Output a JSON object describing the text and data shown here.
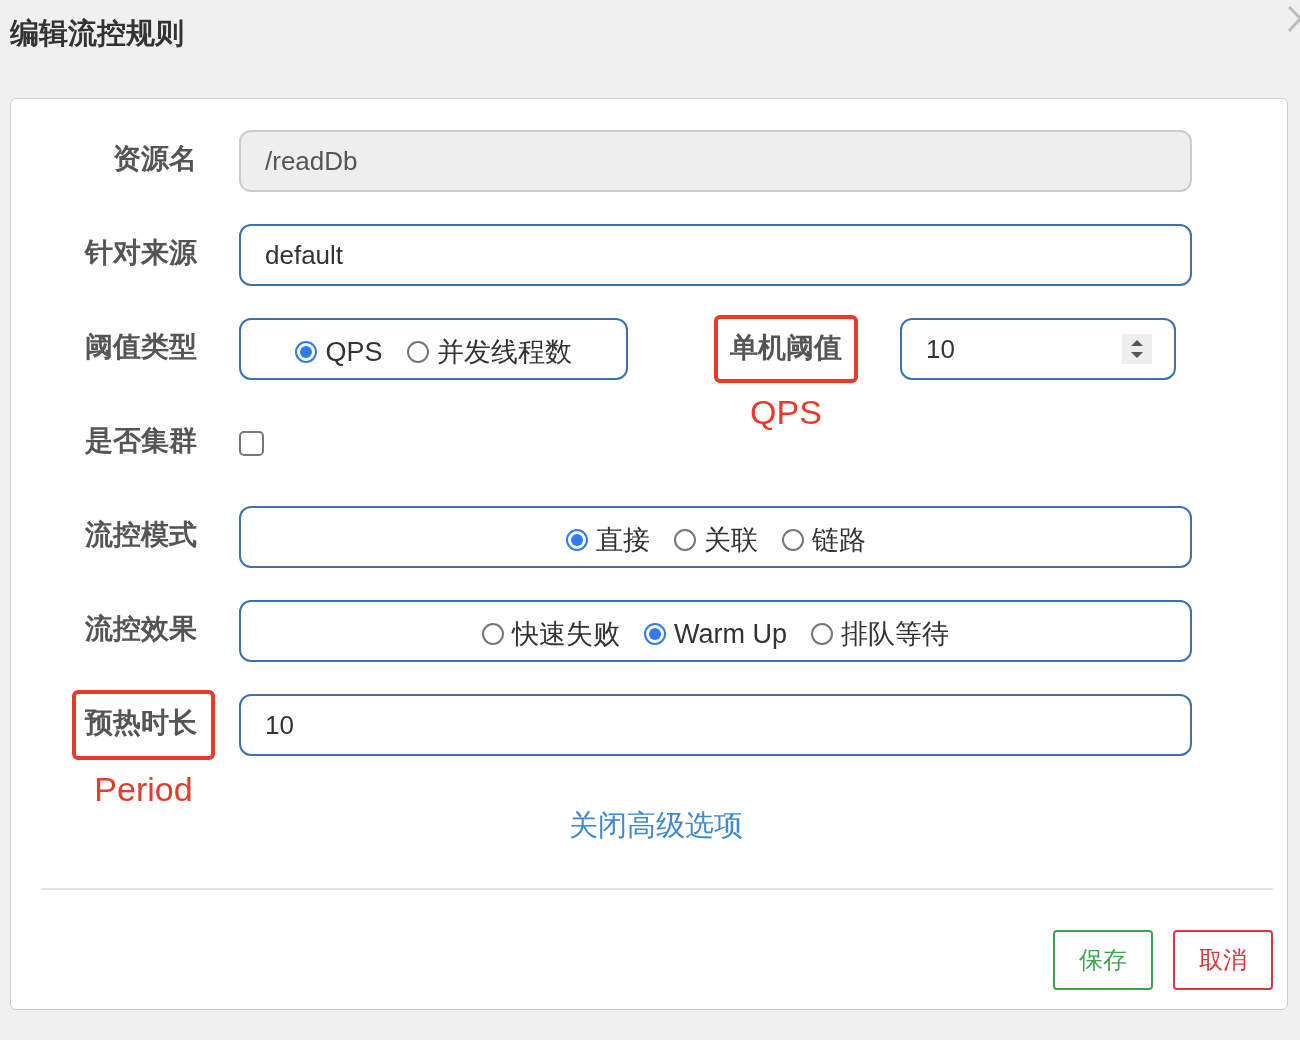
{
  "dialog": {
    "title": "编辑流控规则"
  },
  "form": {
    "rows": [
      {
        "kind": "text",
        "label": "资源名",
        "value": "/readDb",
        "disabled": true,
        "highlighted": false
      },
      {
        "kind": "text",
        "label": "针对来源",
        "value": "default",
        "disabled": false,
        "highlighted": false
      },
      {
        "kind": "radio",
        "label": "阈值类型",
        "highlighted": false,
        "options": [
          {
            "label": "QPS",
            "selected": true
          },
          {
            "label": "并发线程数",
            "selected": false
          }
        ],
        "side": {
          "label": "单机阈值",
          "highlighted": true,
          "annotation": "QPS",
          "value": "10"
        }
      },
      {
        "kind": "checkbox",
        "label": "是否集群",
        "checked": false,
        "highlighted": false
      },
      {
        "kind": "radio",
        "label": "流控模式",
        "highlighted": false,
        "options": [
          {
            "label": "直接",
            "selected": true
          },
          {
            "label": "关联",
            "selected": false
          },
          {
            "label": "链路",
            "selected": false
          }
        ]
      },
      {
        "kind": "radio",
        "label": "流控效果",
        "highlighted": false,
        "options": [
          {
            "label": "快速失败",
            "selected": false
          },
          {
            "label": "Warm Up",
            "selected": true
          },
          {
            "label": "排队等待",
            "selected": false
          }
        ]
      },
      {
        "kind": "text",
        "label": "预热时长",
        "value": "10",
        "disabled": false,
        "highlighted": true,
        "annotation": "Period"
      }
    ],
    "advanced_link": "关闭高级选项"
  },
  "buttons": [
    {
      "label": "保存",
      "kind": "save"
    },
    {
      "label": "取消",
      "kind": "cancel"
    }
  ]
}
